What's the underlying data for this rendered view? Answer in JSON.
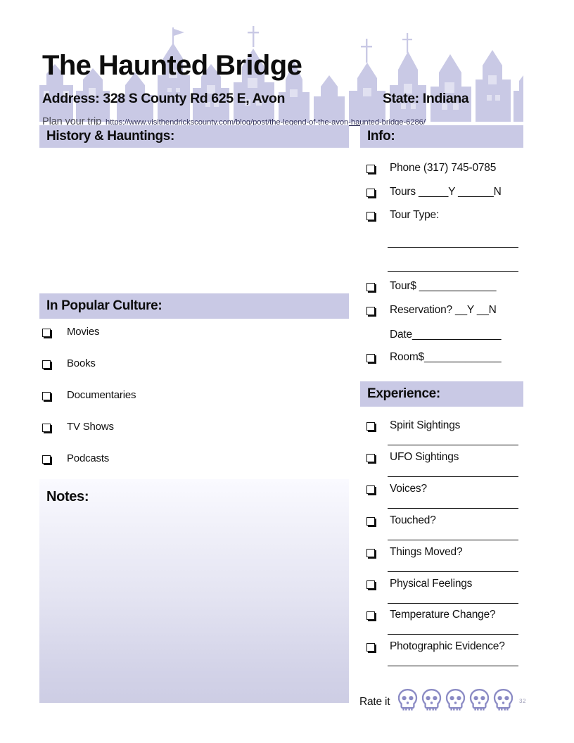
{
  "header": {
    "title": "The Haunted Bridge",
    "address": "Address: 328 S County Rd 625 E, Avon",
    "state": "State: Indiana",
    "plan_label": "Plan your trip",
    "url": "https://www.visithendrickscounty.com/blog/post/the-legend-of-the-avon-haunted-bridge-6286/"
  },
  "sections": {
    "history": {
      "title": "History & Hauntings:"
    },
    "info": {
      "title": "Info:",
      "items": [
        {
          "label": "Phone (317) 745-0785"
        },
        {
          "label": "Tours _____Y ______N"
        },
        {
          "label": "Tour Type:"
        },
        {
          "label": "Tour$ _____________"
        },
        {
          "label": "Reservation?  __Y __N"
        },
        {
          "label": "Room$_____________"
        }
      ],
      "date_row": "Date_______________"
    },
    "popular_culture": {
      "title": "In Popular Culture:",
      "items": [
        {
          "label": "Movies"
        },
        {
          "label": "Books"
        },
        {
          "label": "Documentaries"
        },
        {
          "label": "TV Shows"
        },
        {
          "label": "Podcasts"
        }
      ]
    },
    "notes": {
      "title": "Notes:"
    },
    "experience": {
      "title": "Experience:",
      "items": [
        {
          "label": "Spirit Sightings"
        },
        {
          "label": "UFO Sightings"
        },
        {
          "label": "Voices?"
        },
        {
          "label": "Touched?"
        },
        {
          "label": "Things Moved?"
        },
        {
          "label": "Physical Feelings"
        },
        {
          "label": "Temperature Change?"
        },
        {
          "label": "Photographic Evidence?"
        }
      ]
    }
  },
  "rating": {
    "label": "Rate it",
    "icon": "skull-icon",
    "count": 5
  },
  "footer": {
    "page_number": "32"
  },
  "colors": {
    "band": "#c9c9e5",
    "skull": "#8a8ac4",
    "silhouette": "#c9c9e5",
    "link": "#32325a"
  }
}
